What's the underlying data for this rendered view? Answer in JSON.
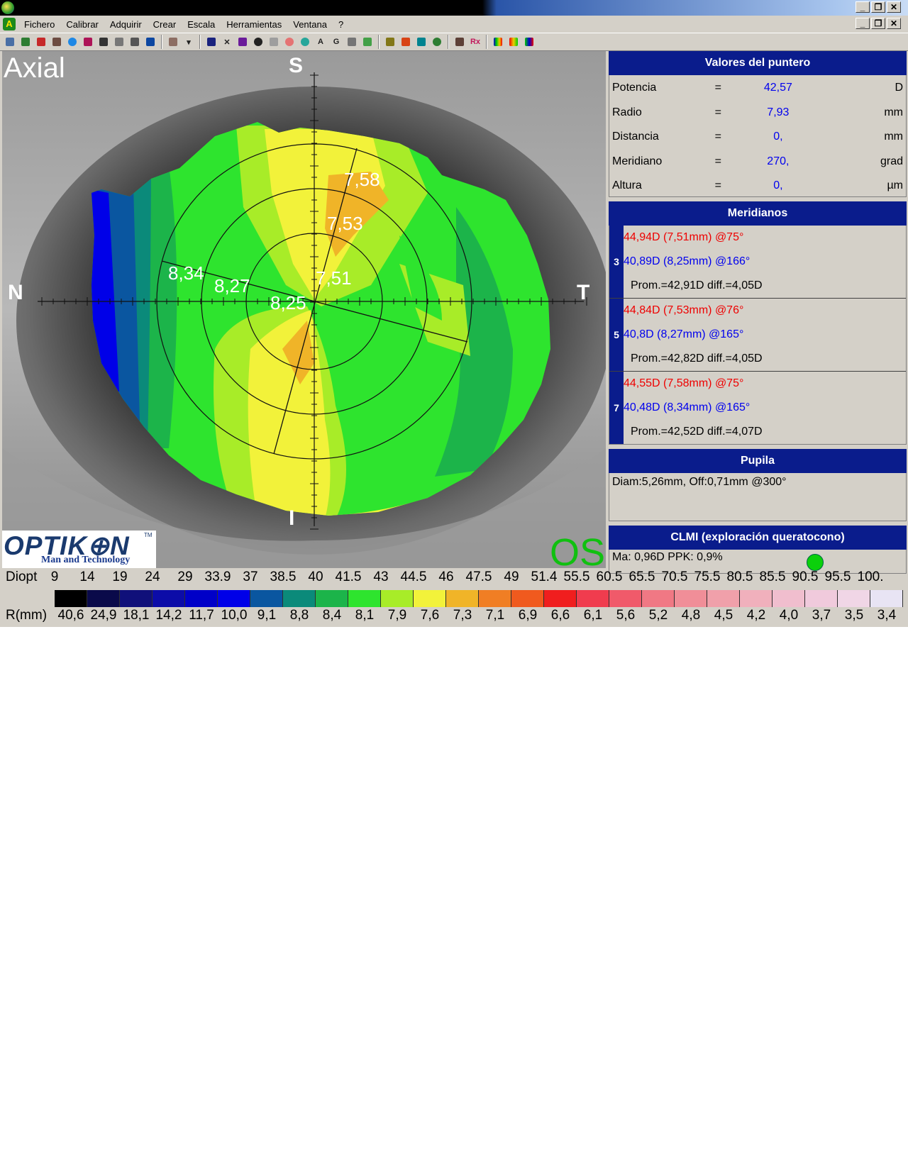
{
  "window": {
    "minimize": "_",
    "restore": "❐",
    "close": "✕"
  },
  "menu": [
    "Fichero",
    "Calibrar",
    "Adquirir",
    "Crear",
    "Escala",
    "Herramientas",
    "Ventana",
    "?"
  ],
  "map": {
    "mode_label": "Axial",
    "orient_top": "S",
    "orient_bottom": "I",
    "orient_left": "N",
    "orient_right": "T",
    "eye_label": "OS",
    "radius_labels": [
      "7,58",
      "7,53",
      "7,51",
      "8,34",
      "8,27",
      "8,25"
    ],
    "logo_main": "OPTIK⊕N",
    "logo_tm": "TM",
    "logo_sub": "Man and Technology"
  },
  "pointer_values": {
    "title": "Valores del puntero",
    "rows": [
      {
        "label": "Potencia",
        "eq": "=",
        "value": "42,57",
        "unit": "D"
      },
      {
        "label": "Radio",
        "eq": "=",
        "value": "7,93",
        "unit": "mm"
      },
      {
        "label": "Distancia",
        "eq": "=",
        "value": "0,",
        "unit": "mm"
      },
      {
        "label": "Meridiano",
        "eq": "=",
        "value": "270,",
        "unit": "grad"
      },
      {
        "label": "Altura",
        "eq": "=",
        "value": "0,",
        "unit": "µm"
      }
    ]
  },
  "meridians": {
    "title": "Meridianos",
    "groups": [
      {
        "zone": "3",
        "steep": "44,94D (7,51mm) @75°",
        "flat": "40,89D (8,25mm) @166°",
        "avg": "Prom.=42,91D  diff.=4,05D"
      },
      {
        "zone": "5",
        "steep": "44,84D (7,53mm) @76°",
        "flat": "40,8D (8,27mm) @165°",
        "avg": "Prom.=42,82D  diff.=4,05D"
      },
      {
        "zone": "7",
        "steep": "44,55D (7,58mm) @75°",
        "flat": "40,48D (8,34mm) @165°",
        "avg": "Prom.=42,52D  diff.=4,07D"
      }
    ]
  },
  "pupil": {
    "title": "Pupila",
    "text": "Diam:5,26mm, Off:0,71mm @300°"
  },
  "clmi": {
    "title": "CLMI (exploración queratocono)",
    "text": "Ma: 0,96D   PPK: 0,9%",
    "status_color": "#0bd00b"
  },
  "scale": {
    "diopt_label": "Diopt",
    "rmm_label": "R(mm)",
    "diopt": [
      "9",
      "14",
      "19",
      "24",
      "29",
      "33.9",
      "37",
      "38.5",
      "40",
      "41.5",
      "43",
      "44.5",
      "46",
      "47.5",
      "49",
      "51.4",
      "55.5",
      "60.5",
      "65.5",
      "70.5",
      "75.5",
      "80.5",
      "85.5",
      "90.5",
      "95.5",
      "100."
    ],
    "rmm": [
      "40,6",
      "24,9",
      "18,1",
      "14,2",
      "11,7",
      "10,0",
      "9,1",
      "8,8",
      "8,4",
      "8,1",
      "7,9",
      "7,6",
      "7,3",
      "7,1",
      "6,9",
      "6,6",
      "6,1",
      "5,6",
      "5,2",
      "4,8",
      "4,5",
      "4,2",
      "4,0",
      "3,7",
      "3,5",
      "3,4"
    ],
    "colors": [
      "#000000",
      "#0a0a4a",
      "#10107a",
      "#0c0ca8",
      "#0000c8",
      "#0000e8",
      "#0a56a0",
      "#0b8a7a",
      "#1cb44a",
      "#2ee42e",
      "#a8ec28",
      "#f2f23a",
      "#f0b428",
      "#f07e24",
      "#f05a1e",
      "#f01e1e",
      "#f03c4e",
      "#f05a6a",
      "#f07884",
      "#f08e98",
      "#f0a0aa",
      "#f0b0bc",
      "#f0bece",
      "#f0cadc",
      "#f0d6e6",
      "#e8e4f4"
    ]
  }
}
